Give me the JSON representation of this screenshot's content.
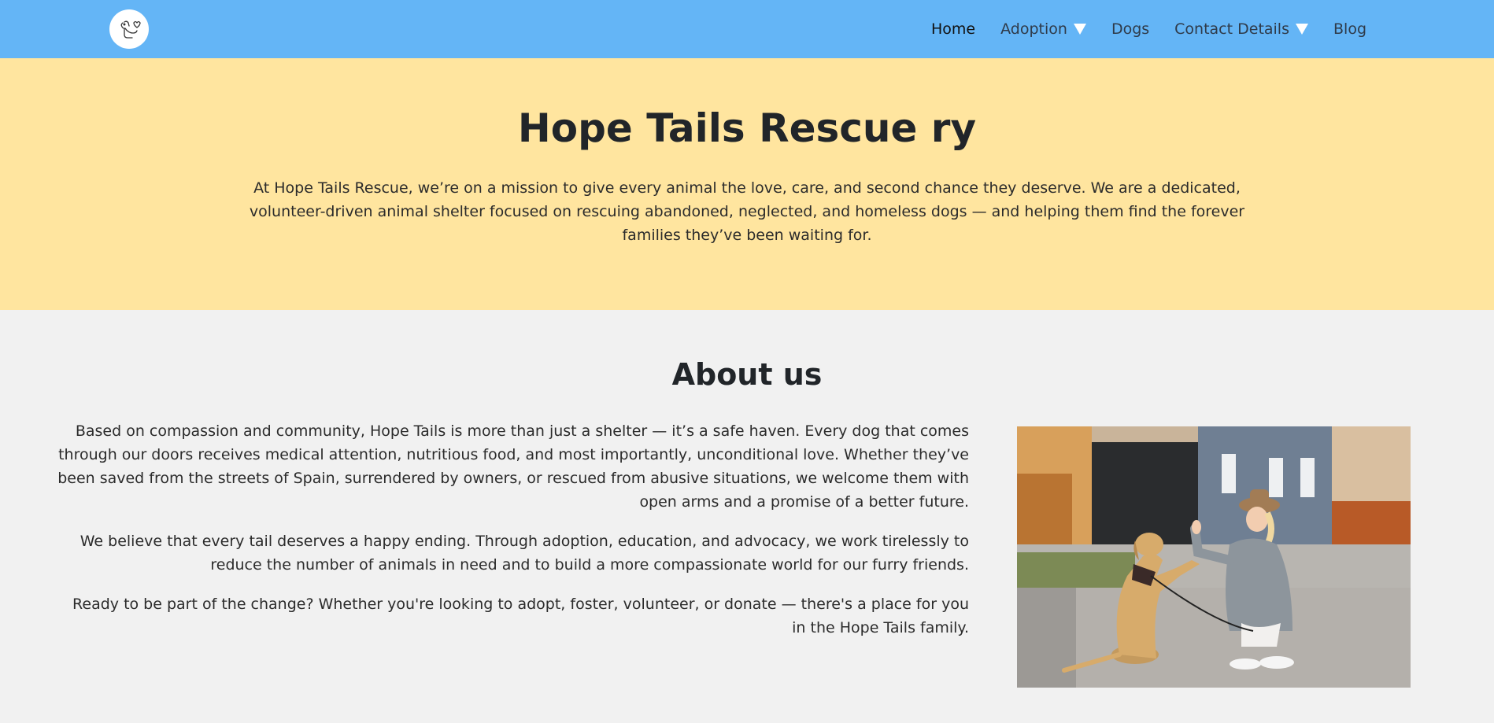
{
  "nav": {
    "logo_icon": "dog-logo-icon",
    "links": [
      {
        "label": "Home",
        "active": true
      },
      {
        "label": "Adoption",
        "dropdown": true
      },
      {
        "label": "Dogs"
      },
      {
        "label": "Contact Details",
        "dropdown": true
      },
      {
        "label": "Blog"
      }
    ]
  },
  "hero": {
    "title": "Hope Tails Rescue ry",
    "text": "At Hope Tails Rescue, we’re on a mission to give every animal the love, care, and second chance they deserve. We are a dedicated, volunteer-driven animal shelter focused on rescuing abandoned, neglected, and homeless dogs — and helping them find the forever families they’ve been waiting for."
  },
  "about": {
    "title": "About us",
    "paragraphs": [
      "Based on compassion and community, Hope Tails is more than just a shelter — it’s a safe haven. Every dog that comes through our doors receives medical attention, nutritious food, and most importantly, unconditional love. Whether they’ve been saved from the streets of Spain, surrendered by owners, or rescued from abusive situations, we welcome them with open arms and a promise of a better future.",
      "We believe that every tail deserves a happy ending. Through adoption, education, and advocacy, we work tirelessly to reduce the number of animals in need and to build a more compassionate world for our furry friends.",
      "Ready to be part of the change? Whether you're looking to adopt, foster, volunteer, or donate — there's a place for you in the Hope Tails family."
    ]
  },
  "colors": {
    "navbar": "#64b5f6",
    "hero_bg": "#ffe59f",
    "page_bg": "#f1f1f1"
  }
}
